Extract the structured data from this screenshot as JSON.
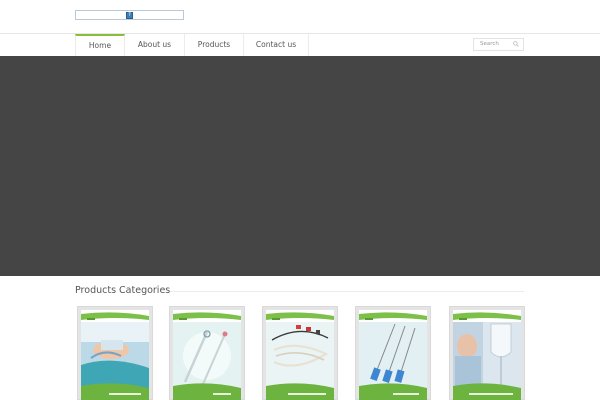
{
  "header": {
    "logo_icon": "broken-image-icon"
  },
  "nav": {
    "items": [
      {
        "label": "Home",
        "active": true
      },
      {
        "label": "About us",
        "active": false
      },
      {
        "label": "Products",
        "active": false
      },
      {
        "label": "Contact us",
        "active": false
      }
    ]
  },
  "search": {
    "placeholder": "Search",
    "icon": "search-icon"
  },
  "banner": {
    "color": "#454545"
  },
  "categories": {
    "heading": "Products Categories",
    "items": [
      {
        "icon": "airway-management-image"
      },
      {
        "icon": "syringe-image"
      },
      {
        "icon": "catheter-tubes-image"
      },
      {
        "icon": "needles-image"
      },
      {
        "icon": "iv-infusion-image"
      }
    ]
  },
  "colors": {
    "accent": "#8bbd3c",
    "card_green": "#6db33f"
  }
}
